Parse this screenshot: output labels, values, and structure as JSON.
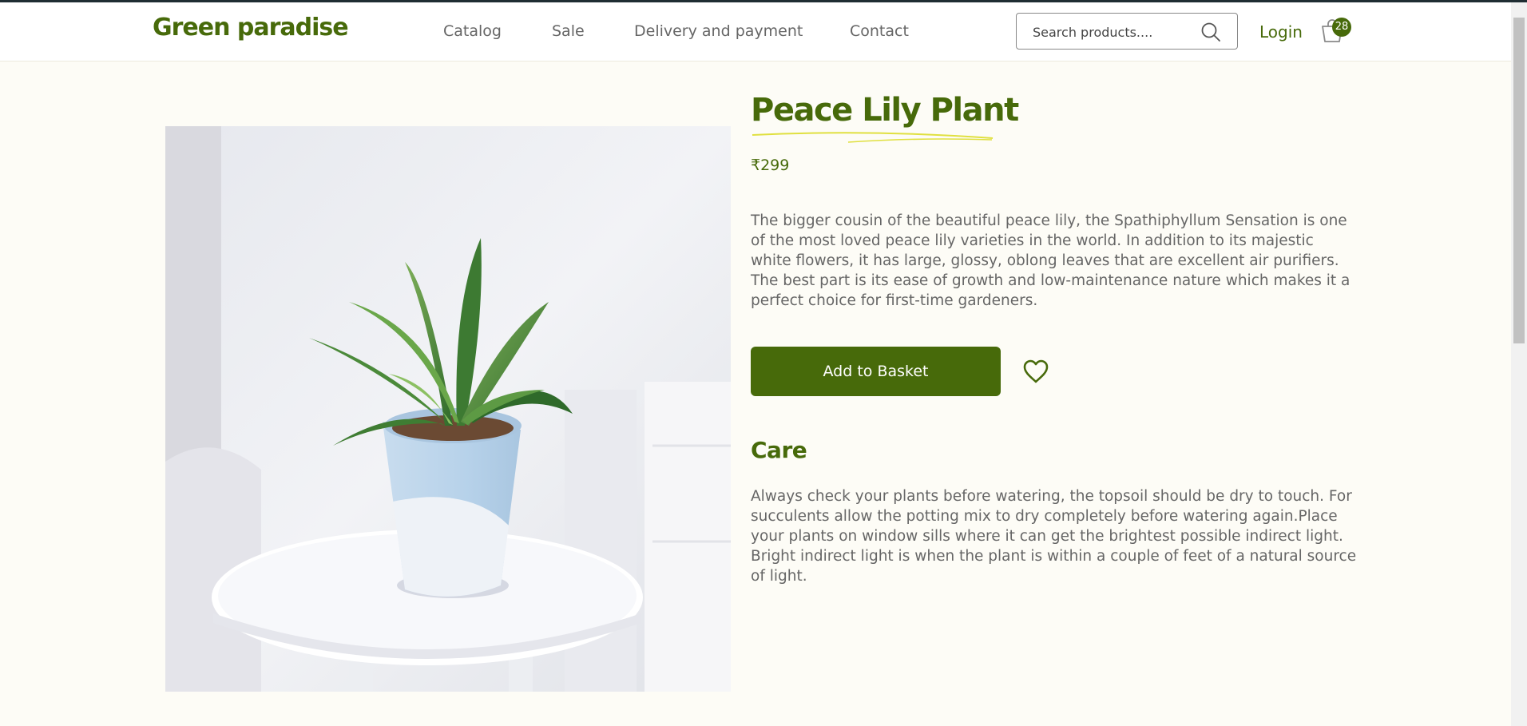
{
  "header": {
    "logo": "Green paradise",
    "nav": [
      {
        "label": "Catalog"
      },
      {
        "label": "Sale"
      },
      {
        "label": "Delivery and payment"
      },
      {
        "label": "Contact"
      }
    ],
    "search": {
      "placeholder": "Search products....",
      "icon": "search-icon"
    },
    "login_label": "Login",
    "basket": {
      "icon": "basket-icon",
      "count": "28"
    }
  },
  "product": {
    "title": "Peace Lily Plant",
    "price": "₹299",
    "description": "The bigger cousin of the beautiful peace lily, the Spathiphyllum Sensation is one of the most loved peace lily varieties in the world. In addition to its majestic white flowers, it has large, glossy, oblong leaves that are excellent air purifiers. The best part is its ease of growth and low-maintenance nature which makes it a perfect choice for first-time gardeners.",
    "add_to_basket_label": "Add to Basket",
    "wishlist_icon": "heart-icon",
    "care_heading": "Care",
    "care_text": "Always check your plants before watering, the topsoil should be dry to touch. For succulents allow the potting mix to dry completely before watering again.Place your plants on window sills where it can get the brightest possible indirect light. Bright indirect light is when the plant is within a couple of feet of a natural source of light."
  },
  "colors": {
    "brand": "#476a0a",
    "background": "#fdfcf6",
    "title_underline": "#e0e040"
  }
}
